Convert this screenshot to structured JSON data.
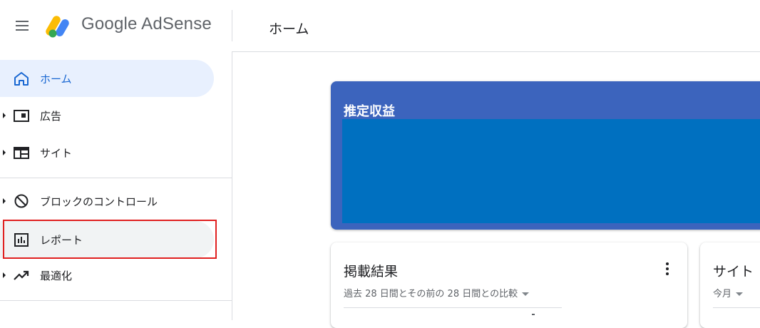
{
  "header": {
    "brand": "Google AdSense",
    "page_title": "ホーム",
    "colors": {
      "logo_yellow": "#fbbc04",
      "logo_blue": "#4285f4"
    }
  },
  "sidebar": {
    "items": [
      {
        "label": "ホーム",
        "icon": "home-icon",
        "active": true,
        "expandable": false
      },
      {
        "label": "広告",
        "icon": "ads-icon",
        "active": false,
        "expandable": true
      },
      {
        "label": "サイト",
        "icon": "sites-icon",
        "active": false,
        "expandable": true
      },
      {
        "label": "ブロックのコントロール",
        "icon": "block-icon",
        "active": false,
        "expandable": true
      },
      {
        "label": "レポート",
        "icon": "report-icon",
        "active": false,
        "expandable": false,
        "highlighted": true
      },
      {
        "label": "最適化",
        "icon": "trending-icon",
        "active": false,
        "expandable": true
      }
    ]
  },
  "main": {
    "earnings_card": {
      "title": "推定収益",
      "color": "#3c64bd",
      "fill_color": "#0070c0"
    },
    "performance_card": {
      "title": "掲載結果",
      "subtitle": "過去 28 日間とその前の 28 日間との比較"
    },
    "site_card": {
      "title": "サイト",
      "period": "今月"
    }
  },
  "annotation": {
    "highlight_color": "#e02020"
  }
}
